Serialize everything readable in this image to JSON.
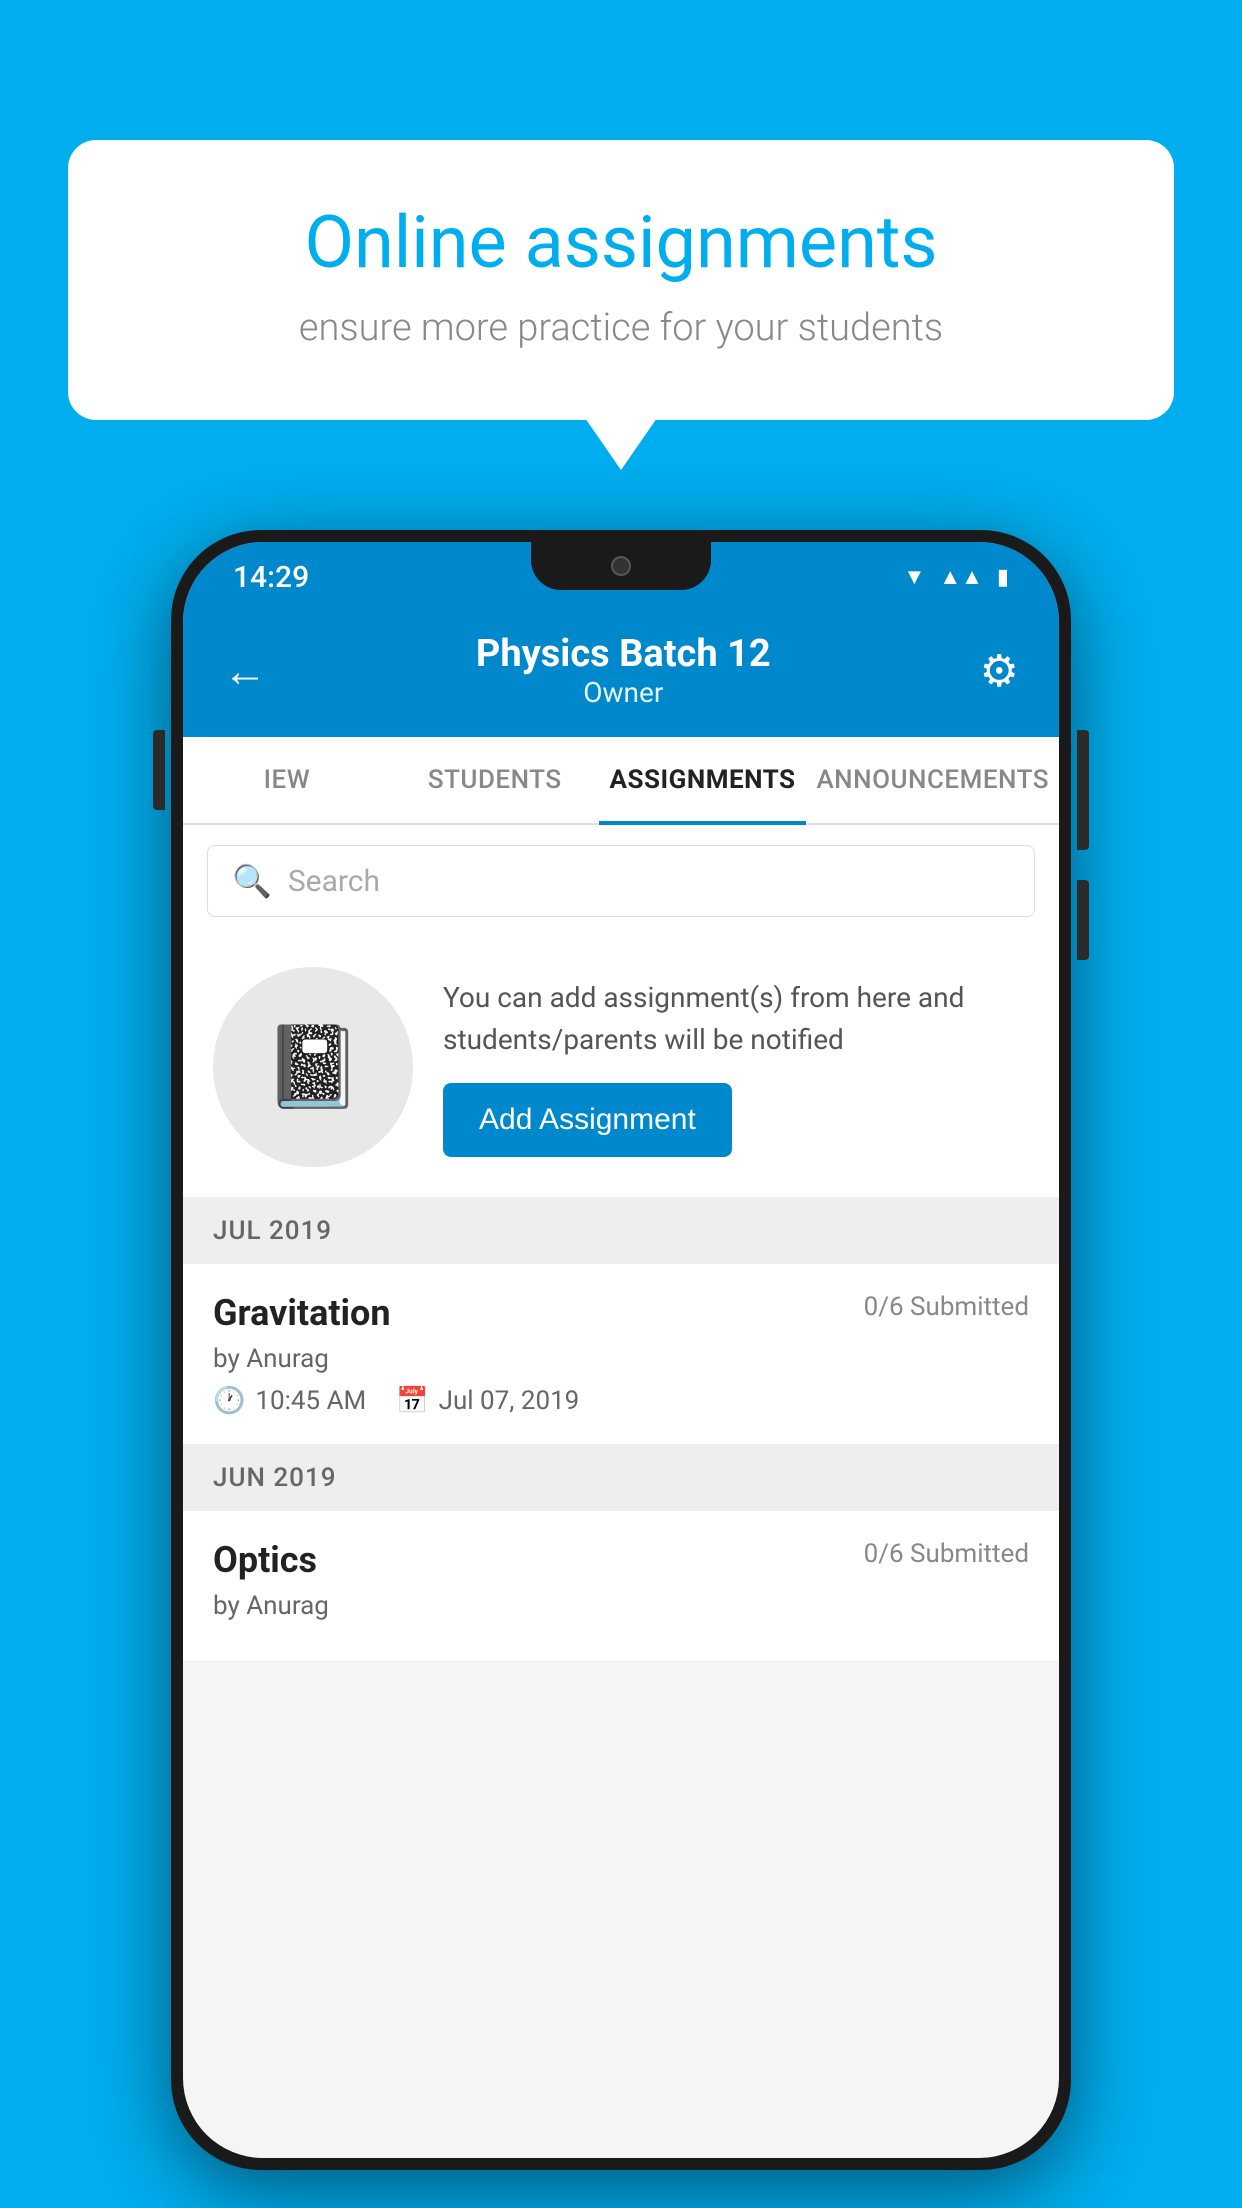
{
  "background": {
    "color": "#00AEEF"
  },
  "speech_bubble": {
    "title": "Online assignments",
    "subtitle": "ensure more practice for your students"
  },
  "phone": {
    "status_bar": {
      "time": "14:29",
      "icons": [
        "wifi",
        "signal",
        "battery"
      ]
    },
    "header": {
      "title": "Physics Batch 12",
      "subtitle": "Owner",
      "back_label": "←",
      "settings_label": "⚙"
    },
    "tabs": [
      {
        "label": "IEW",
        "active": false
      },
      {
        "label": "STUDENTS",
        "active": false
      },
      {
        "label": "ASSIGNMENTS",
        "active": true
      },
      {
        "label": "ANNOUNCEMENTS",
        "active": false
      }
    ],
    "search": {
      "placeholder": "Search"
    },
    "promo": {
      "description": "You can add assignment(s) from here and students/parents will be notified",
      "button_label": "Add Assignment"
    },
    "months": [
      {
        "label": "JUL 2019",
        "assignments": [
          {
            "name": "Gravitation",
            "submitted": "0/6 Submitted",
            "by": "by Anurag",
            "time": "10:45 AM",
            "date": "Jul 07, 2019"
          }
        ]
      },
      {
        "label": "JUN 2019",
        "assignments": [
          {
            "name": "Optics",
            "submitted": "0/6 Submitted",
            "by": "by Anurag",
            "time": "",
            "date": ""
          }
        ]
      }
    ]
  }
}
